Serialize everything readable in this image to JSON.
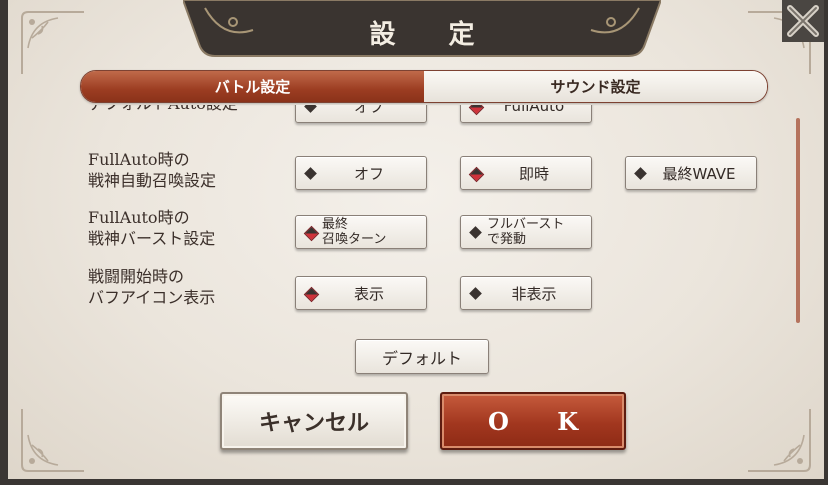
{
  "dialog": {
    "title": "設 定"
  },
  "tabs": [
    {
      "label": "バトル設定",
      "active": true
    },
    {
      "label": "サウンド設定",
      "active": false
    }
  ],
  "settings": [
    {
      "label_lines": [
        "デフォルトAuto設定"
      ],
      "options": [
        {
          "label": "オフ",
          "selected": false
        },
        {
          "label": "FullAuto",
          "selected": true
        }
      ]
    },
    {
      "label_lines": [
        "FullAuto時の",
        "戦神自動召喚設定"
      ],
      "options": [
        {
          "label": "オフ",
          "selected": false
        },
        {
          "label": "即時",
          "selected": true
        },
        {
          "label": "最終WAVE",
          "selected": false
        }
      ]
    },
    {
      "label_lines": [
        "FullAuto時の",
        "戦神バースト設定"
      ],
      "options": [
        {
          "label_lines": [
            "最終",
            "召喚ターン"
          ],
          "selected": true
        },
        {
          "label_lines": [
            "フルバースト",
            "で発動"
          ],
          "selected": false
        }
      ]
    },
    {
      "label_lines": [
        "戦闘開始時の",
        "バフアイコン表示"
      ],
      "options": [
        {
          "label": "表示",
          "selected": true
        },
        {
          "label": "非表示",
          "selected": false
        }
      ]
    }
  ],
  "buttons": {
    "default": "デフォルト",
    "cancel": "キャンセル",
    "ok": "O K"
  },
  "colors": {
    "accent": "#9c3d22",
    "selected_diamond": "#d0323a",
    "panel": "#ebe5dc",
    "title_plate": "#3a3430"
  },
  "icons": {
    "close": "x-icon",
    "selected_marker": "red-diamond-icon",
    "unselected_marker": "dark-diamond-icon"
  }
}
